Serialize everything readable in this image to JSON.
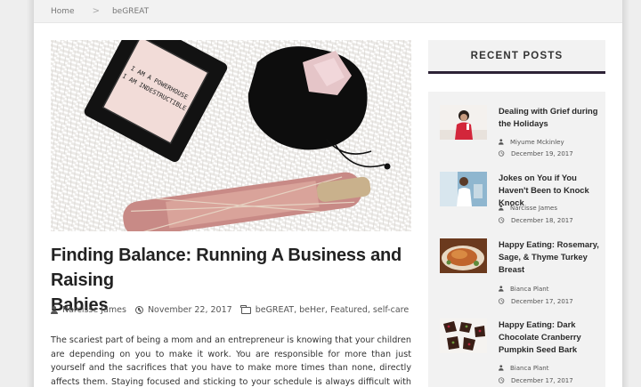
{
  "breadcrumb": {
    "home": "Home",
    "separator": ">",
    "current": "beGREAT"
  },
  "hero": {
    "label_line1": "I AM A POWERHOUSE",
    "label_line2": "I AM INDESTRUCTIBLE"
  },
  "post": {
    "title_line1": "Finding Balance: Running A Business and Raising",
    "title_line2": "Babies",
    "author": "Narcisse James",
    "date": "November 22, 2017",
    "categories": "beGREAT, beHer, Featured, self-care",
    "excerpt": "The scariest part of being a mom and an entrepreneur is knowing that your children are depending on you to make it work. You are responsible for more than just yourself and the sacrifices that you have to make more times than none, directly affects them. Staying focused and sticking to your schedule is always difficult with kids demanding your attention."
  },
  "sidebar": {
    "heading": "RECENT POSTS",
    "posts": [
      {
        "title": "Dealing with Grief during the Holidays",
        "author": "Miyume Mckinley",
        "date": "December 19, 2017"
      },
      {
        "title": "Jokes on You if You Haven't Been to Knock Knock",
        "author": "Narcisse James",
        "date": "December 18, 2017"
      },
      {
        "title": "Happy Eating: Rosemary, Sage, & Thyme Turkey Breast",
        "author": "Bianca Plant",
        "date": "December 17, 2017"
      },
      {
        "title": "Happy Eating: Dark Chocolate Cranberry Pumpkin Seed Bark",
        "author": "Bianca Plant",
        "date": "December 17, 2017"
      }
    ]
  },
  "colors": {
    "accent_bar": "#2d2236",
    "panel_bg": "#f2f2f2"
  }
}
